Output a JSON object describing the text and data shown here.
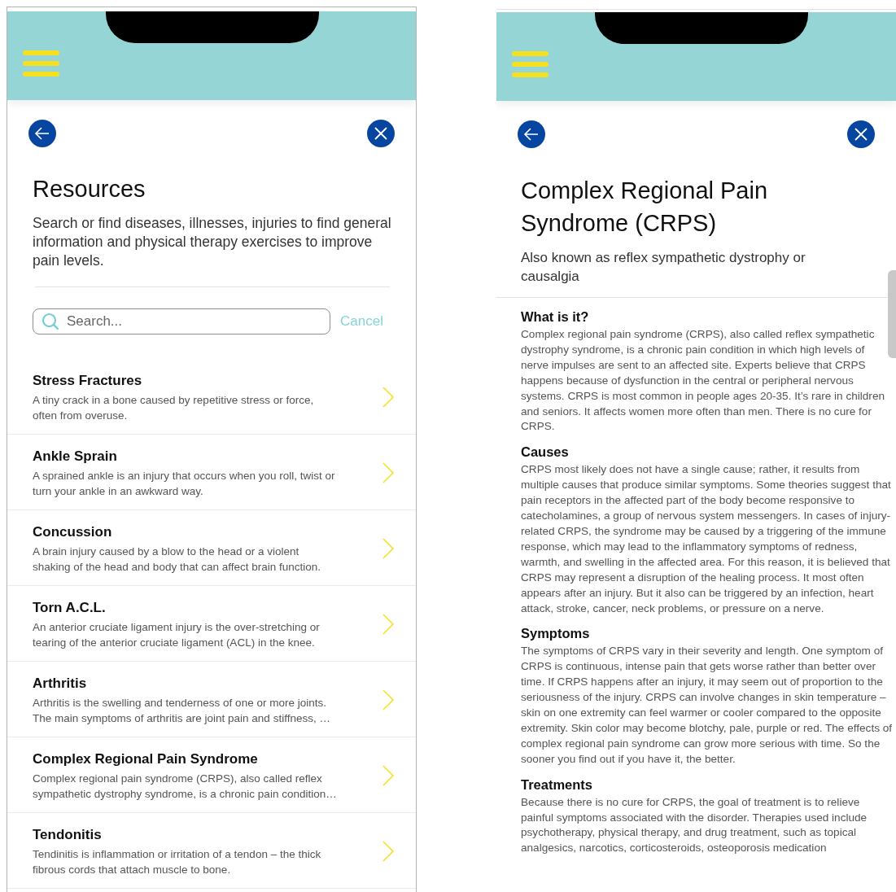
{
  "resources_screen": {
    "title": "Resources",
    "description": "Search or find diseases, illnesses, injuries to find general information and physical therapy exercises to improve pain levels.",
    "search": {
      "placeholder": "Search..."
    },
    "cancel": "Cancel",
    "items": [
      {
        "title": "Stress Fractures",
        "summary": "A tiny crack in a bone caused by repetitive stress or force, often from overuse."
      },
      {
        "title": "Ankle Sprain",
        "summary": "A sprained ankle is an injury that occurs when you roll, twist or turn your ankle in an awkward way."
      },
      {
        "title": "Concussion",
        "summary": "A brain injury caused by a blow to the head or a violent shaking of the head and body that can affect brain function."
      },
      {
        "title": "Torn A.C.L.",
        "summary": "An anterior cruciate ligament injury is the over-stretching or tearing of the anterior cruciate ligament (ACL) in the knee."
      },
      {
        "title": "Arthritis",
        "summary": "Arthritis is the swelling and tenderness of one or more joints. The main symptoms of arthritis are joint pain and stiffness, …"
      },
      {
        "title": "Complex Regional Pain Syndrome",
        "summary": "Complex regional pain syndrome (CRPS), also called reflex sympathetic dystrophy syndrome, is a chronic pain condition…"
      },
      {
        "title": "Tendonitis",
        "summary": "Tendinitis is inflammation or irritation of a tendon – the thick fibrous cords that attach muscle to bone."
      }
    ]
  },
  "detail_screen": {
    "title": "Complex Regional Pain Syndrome (CRPS)",
    "subtitle": "Also known as reflex sympathetic dystrophy or causalgia",
    "sections": [
      {
        "heading": "What is it?",
        "text": "Complex regional pain syndrome (CRPS), also called reflex sympathetic dystrophy syndrome, is a chronic pain condition in which high levels of nerve impulses are sent to an affected site. Experts believe that CRPS happens because of dysfunction in the central or peripheral nervous systems. CRPS is most common in people ages 20-35. It’s rare in children and seniors. It affects women more often than men. There is no cure for CRPS."
      },
      {
        "heading": "Causes",
        "text": "CRPS most likely does not have a single cause; rather, it results from multiple causes that produce similar symptoms. Some theories suggest that pain receptors in the affected part of the body become responsive to catecholamines, a group of nervous system messengers. In cases of injury-related CRPS, the syndrome may be caused by a triggering of the immune response, which may lead to the inflammatory symptoms of redness, warmth, and swelling in the affected area. For this reason, it is believed that CRPS may represent a disruption of the healing process. It most often appears after an injury. But it also can be triggered by an infection, heart attack, stroke, cancer, neck problems, or pressure on a nerve."
      },
      {
        "heading": "Symptoms",
        "text": "The symptoms of CRPS vary in their severity and length. One symptom of CRPS is continuous, intense pain that gets worse rather than better over time. If CRPS happens after an injury, it may seem out of proportion to the seriousness of the injury. CRPS can involve changes in skin temperature – skin on one extremity can feel warmer or cooler compared to the opposite extremity. Skin color may become blotchy, pale, purple or red. The effects of complex regional pain syndrome can grow more serious with time. So the sooner you find out if you have it, the better."
      },
      {
        "heading": "Treatments",
        "text": "Because there is no cure for CRPS, the goal of treatment is to relieve painful symptoms associated with the disorder. Therapies used include psychotherapy, physical therapy, and drug treatment, such as topical analgesics, narcotics, corticosteroids, osteoporosis medication"
      }
    ]
  }
}
